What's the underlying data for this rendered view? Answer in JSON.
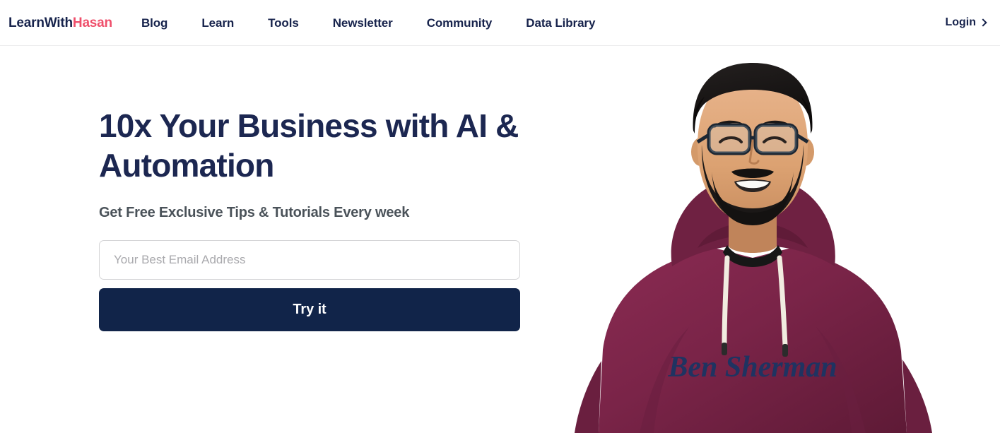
{
  "header": {
    "brand": {
      "first": "LearnWith",
      "second": "Hasan",
      "full": "LearnWithHasan",
      "color_first": "#17234c",
      "color_second": "#ef4f6b"
    },
    "nav_items": [
      {
        "label": "Blog"
      },
      {
        "label": "Learn"
      },
      {
        "label": "Tools"
      },
      {
        "label": "Newsletter"
      },
      {
        "label": "Community"
      },
      {
        "label": "Data Library"
      }
    ],
    "login": {
      "label": "Login",
      "icon": "chevron-right-icon"
    }
  },
  "hero": {
    "title": "10x Your Business with AI & Automation",
    "subtitle": "Get Free Exclusive Tips & Tutorials Every week",
    "email_field": {
      "placeholder": "Your Best Email Address",
      "value": ""
    },
    "submit_button": {
      "label": "Try it",
      "background": "#112449",
      "text_color": "#ffffff"
    },
    "photo": {
      "alt": "Smiling bearded man wearing glasses and a maroon Ben Sherman hoodie",
      "hoodie_text": "Ben Sherman",
      "hoodie_color": "#7a2448",
      "background": "#ffffff"
    }
  },
  "theme": {
    "navy": "#17234c",
    "deep_navy": "#112449",
    "accent_pink": "#ef4f6b",
    "body_gray": "#4a5259",
    "border_gray": "#ececee",
    "placeholder_gray": "#a9a9ad",
    "page_background": "#ffffff"
  }
}
